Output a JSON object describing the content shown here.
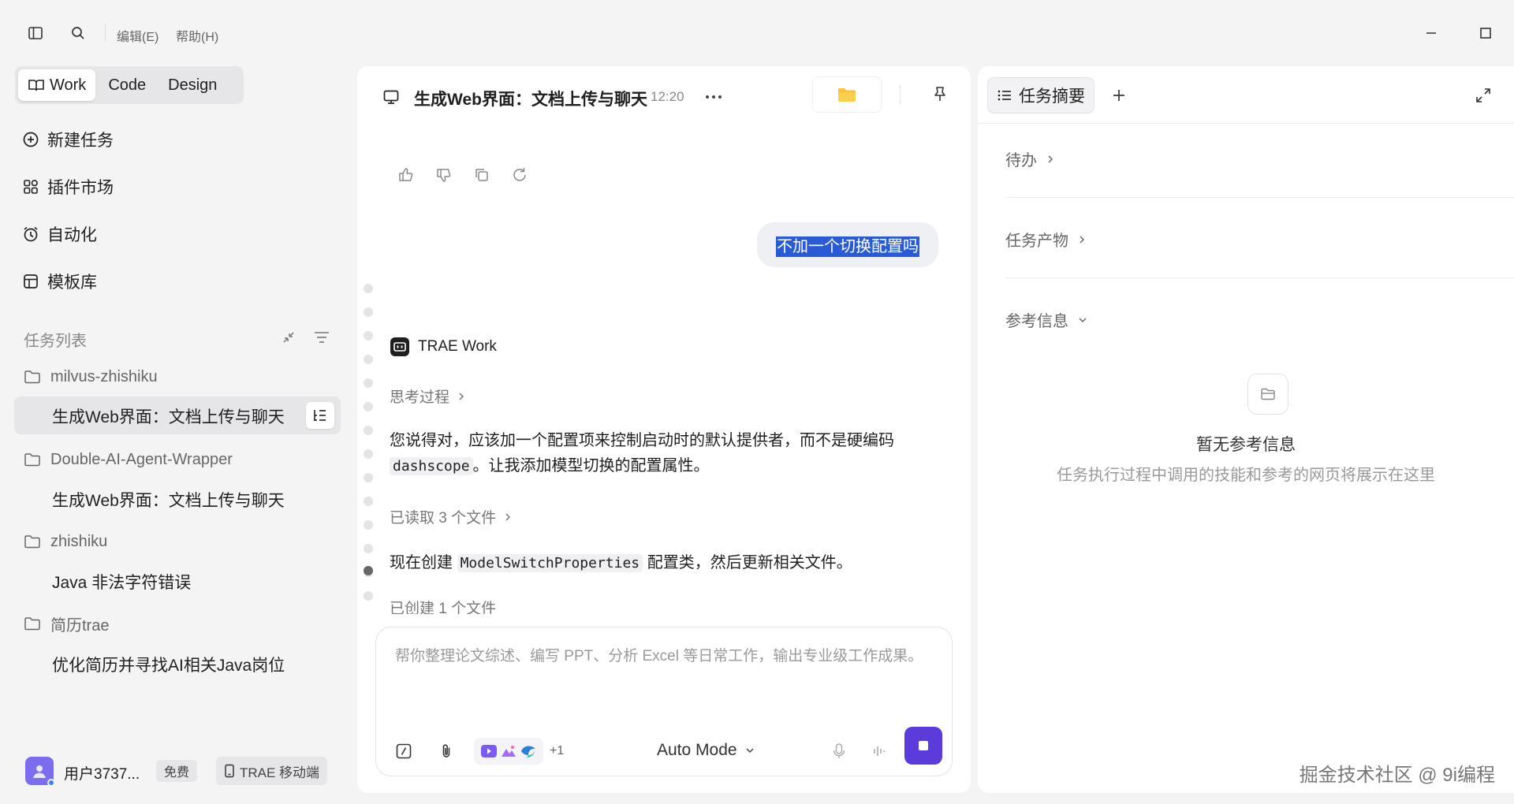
{
  "menu": {
    "edit": "编辑(E)",
    "help": "帮助(H)"
  },
  "modes": {
    "work": "Work",
    "code": "Code",
    "design": "Design"
  },
  "nav": {
    "new_task": "新建任务",
    "plugins": "插件市场",
    "automation": "自动化",
    "templates": "模板库"
  },
  "task_list": {
    "title": "任务列表",
    "groups": [
      {
        "folder": "milvus-zhishiku",
        "tasks": [
          "生成Web界面：文档上传与聊天"
        ]
      },
      {
        "folder": "Double-AI-Agent-Wrapper",
        "tasks": [
          "生成Web界面：文档上传与聊天"
        ]
      },
      {
        "folder": "zhishiku",
        "tasks": [
          "Java 非法字符错误"
        ]
      },
      {
        "folder": "简历trae",
        "tasks": [
          "优化简历并寻找AI相关Java岗位"
        ]
      }
    ]
  },
  "user": {
    "name": "用户3737...",
    "plan": "免费",
    "mobile": "TRAE 移动端"
  },
  "chat": {
    "title": "生成Web界面：文档上传与聊天",
    "time": "12:20",
    "user_message": "不加一个切换配置吗",
    "agent_name": "TRAE Work",
    "thinking": "思考过程",
    "reply_p1_a": "您说得对，应该加一个配置项来控制启动时的默认提供者，而不是硬编码",
    "reply_code1": "dashscope",
    "reply_p1_b": "。让我添加模型切换的配置属性。",
    "read_files": "已读取 3 个文件",
    "reply_p2_a": "现在创建",
    "reply_code2": "ModelSwitchProperties",
    "reply_p2_b": "配置类，然后更新相关文件。",
    "created_files": "已创建 1 个文件",
    "input_placeholder": "帮你整理论文综述、编写 PPT、分析 Excel 等日常工作，输出专业级工作成果。",
    "plus_count": "+1",
    "mode": "Auto Mode"
  },
  "right_panel": {
    "tab": "任务摘要",
    "todo": "待办",
    "outputs": "任务产物",
    "references": "参考信息",
    "empty_title": "暂无参考信息",
    "empty_sub": "任务执行过程中调用的技能和参考的网页将展示在这里"
  },
  "watermark": "掘金技术社区 @ 9i编程",
  "colors": {
    "accent": "#5b3cdb",
    "selection": "#2a5bd7",
    "avatar": "#7b6cf0"
  }
}
